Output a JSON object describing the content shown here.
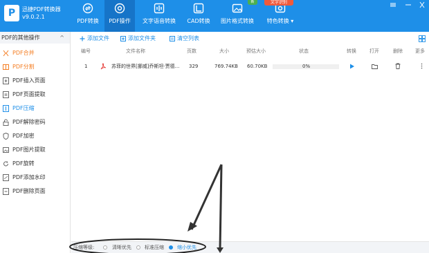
{
  "app": {
    "title": "迅捷PDF转换器",
    "version": "v9.0.2.1",
    "logo_glyph": "P"
  },
  "nav": {
    "items": [
      {
        "label": "PDF转换",
        "icon": "pdf-convert-icon"
      },
      {
        "label": "PDF操作",
        "icon": "pdf-operation-icon"
      },
      {
        "label": "文字语音转换",
        "icon": "voice-icon"
      },
      {
        "label": "CAD转换",
        "icon": "cad-icon"
      },
      {
        "label": "图片格式转换",
        "icon": "image-icon"
      },
      {
        "label": "特色转换 ▾",
        "icon": "special-icon"
      }
    ],
    "active_index": 1,
    "badge_new": "新",
    "badge_video": "文字识别"
  },
  "sidebar": {
    "header": "PDF的其他操作",
    "header_chevron": "^",
    "items": [
      {
        "label": "PDF合并",
        "state": "hl"
      },
      {
        "label": "PDF分割",
        "state": "hl"
      },
      {
        "label": "PDF插入页面",
        "state": ""
      },
      {
        "label": "PDF页面提取",
        "state": ""
      },
      {
        "label": "PDF压缩",
        "state": "active"
      },
      {
        "label": "PDF解除密码",
        "state": ""
      },
      {
        "label": "PDF加密",
        "state": ""
      },
      {
        "label": "PDF图片提取",
        "state": ""
      },
      {
        "label": "PDF旋转",
        "state": ""
      },
      {
        "label": "PDF添加水印",
        "state": ""
      },
      {
        "label": "PDF删除页面",
        "state": ""
      }
    ]
  },
  "toolbar": {
    "add_file": "添加文件",
    "add_folder": "添加文件夹",
    "clear_list": "清空列表"
  },
  "table": {
    "headers": {
      "index": "编号",
      "name": "文件名称",
      "pages": "页数",
      "size": "大小",
      "est_size": "预估大小",
      "status": "状态",
      "convert": "转换",
      "open": "打开",
      "delete": "删除",
      "more": "更多"
    },
    "rows": [
      {
        "index": "1",
        "name": "苏菲的世界[挪威]乔斯坦·贾德...",
        "pages": "329",
        "size": "769.74KB",
        "est_size": "60.70KB",
        "status": "0%",
        "progress": 0
      }
    ]
  },
  "compress": {
    "label": "压缩等级:",
    "options": [
      "清晰优先",
      "标准压缩",
      "缩小优先"
    ],
    "selected": 2
  },
  "colors": {
    "accent": "#1e8fe8",
    "highlight": "#f47c20"
  }
}
